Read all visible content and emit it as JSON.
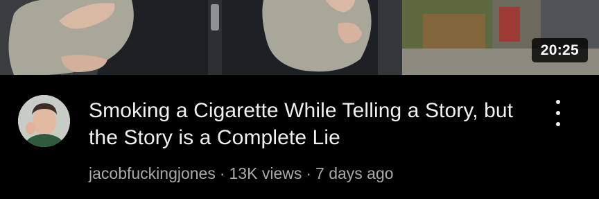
{
  "video": {
    "duration": "20:25",
    "title": "Smoking a Cigarette While Telling a Story, but the Story is a Complete Lie",
    "channel": "jacobfuckingjones",
    "views": "13K views",
    "age": "7 days ago",
    "separator": "·"
  },
  "icons": {
    "more": "more-vert-icon"
  },
  "colors": {
    "background": "#000000",
    "title": "#f1f1f1",
    "byline": "#aaaaaa",
    "duration_bg": "#000000cc"
  }
}
